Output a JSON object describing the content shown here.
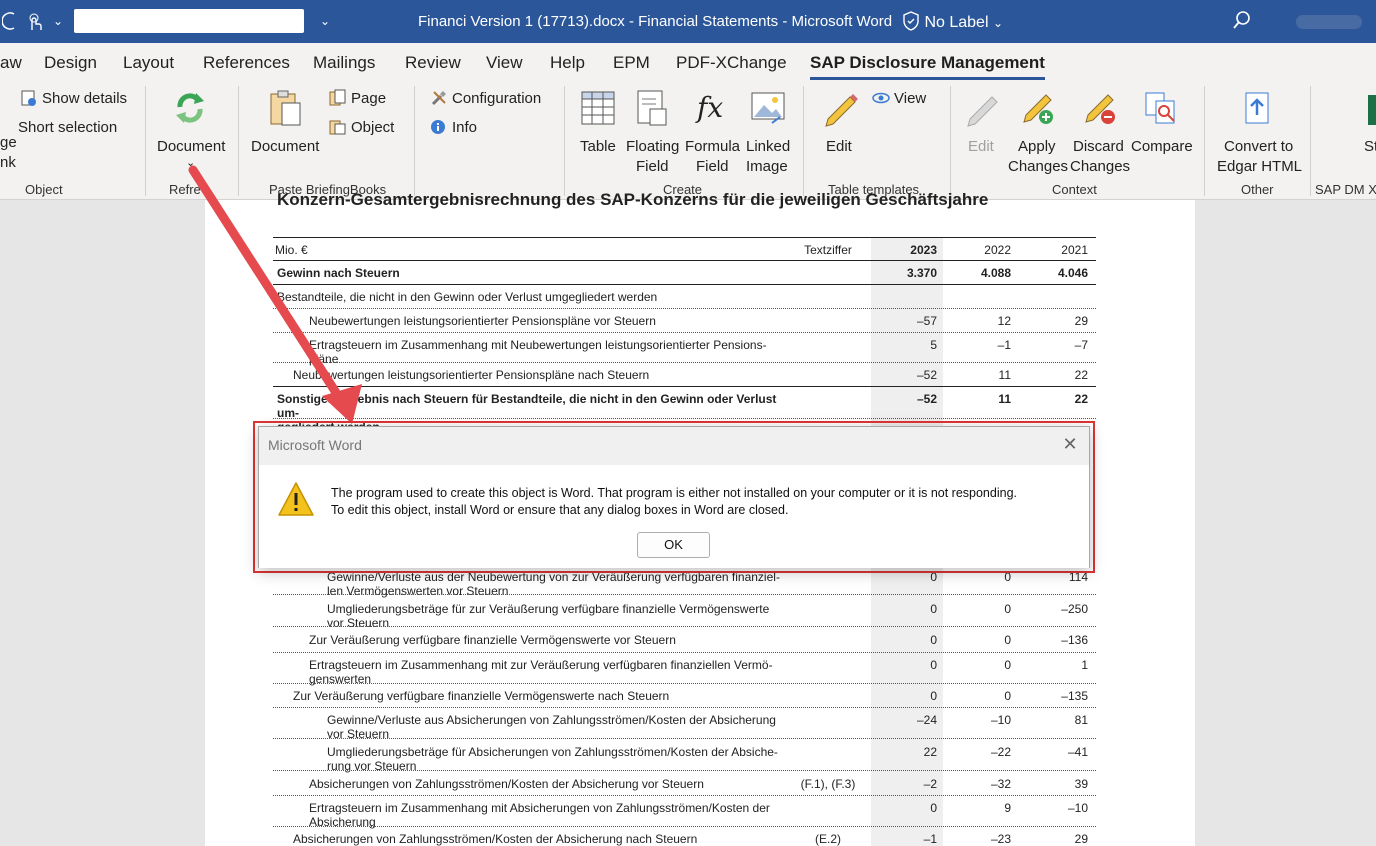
{
  "titlebar": {
    "title": "Financi Version 1 (17713).docx  -  Financial Statements  -  Microsoft Word",
    "label": "No Label",
    "icons": [
      "refresh-icon",
      "touch-icon",
      "dropdown-icon",
      "customize-icon",
      "shield-icon",
      "search-icon"
    ]
  },
  "tabs": [
    "aw",
    "Design",
    "Layout",
    "References",
    "Mailings",
    "Review",
    "View",
    "Help",
    "EPM",
    "PDF-XChange",
    "SAP Disclosure Management"
  ],
  "ribbon": {
    "object_group": {
      "show_details": "Show details",
      "short_selection": "Short selection",
      "partial_top": "ge",
      "partial_bottom": "nk",
      "label": "Object"
    },
    "refresh_group": {
      "document": "Document",
      "label": "Refre"
    },
    "paste_group": {
      "document": "Document",
      "page": "Page",
      "object": "Object",
      "label": "Paste BriefingBooks"
    },
    "config_group": {
      "configuration": "Configuration",
      "info": "Info"
    },
    "create_group": {
      "table": "Table",
      "floating_1": "Floating",
      "floating_2": "Field",
      "formula_1": "Formula",
      "formula_2": "Field",
      "linked_1": "Linked",
      "linked_2": "Image",
      "label": "Create"
    },
    "templates_group": {
      "edit": "Edit",
      "view": "View",
      "label": "Table templates"
    },
    "context_group": {
      "edit": "Edit",
      "apply_1": "Apply",
      "apply_2": "Changes",
      "discard_1": "Discard",
      "discard_2": "Changes",
      "compare": "Compare",
      "label": "Context"
    },
    "other_group": {
      "convert_1": "Convert to",
      "convert_2": "Edgar HTML",
      "label": "Other"
    },
    "sapdm_group": {
      "partial": "St",
      "label": "SAP DM XI"
    }
  },
  "document": {
    "heading": "Konzern-Gesamtergebnisrechnung des SAP-Konzerns für die jeweiligen Geschäftsjahre",
    "headers": {
      "label": "Mio. €",
      "tz": "Textziffer",
      "y2023": "2023",
      "y2022": "2022",
      "y2021": "2021"
    },
    "highlight_color": "#ffc000",
    "rows": [
      {
        "label": "Gewinn nach Steuern",
        "tz": "",
        "v23": "3.370",
        "v22": "4.088",
        "v21": "4.046"
      },
      {
        "label": "Bestandteile, die nicht in den Gewinn oder Verlust umgegliedert werden",
        "tz": "",
        "v23": "",
        "v22": "",
        "v21": ""
      },
      {
        "label": "Neubewertungen leistungsorientierter Pensionspläne vor Steuern",
        "tz": "",
        "v23": "–57",
        "v22": "12",
        "v21": "29"
      },
      {
        "label": "Ertragsteuern im Zusammenhang mit Neubewertungen leistungsorientierter Pensions-",
        "label2": "pläne",
        "tz": "",
        "v23": "5",
        "v22": "–1",
        "v21": "–7"
      },
      {
        "label": "Neubewertungen leistungsorientierter Pensionspläne nach Steuern",
        "tz": "",
        "v23": "–52",
        "v22": "11",
        "v21": "22"
      },
      {
        "label": "Sonstiges Ergebnis nach Steuern für Bestandteile, die nicht in den Gewinn oder Verlust um-",
        "label2": "gegliedert werden",
        "tz": "",
        "v23": "–52",
        "v22": "11",
        "v21": "22"
      },
      {
        "label": "Gewinne/Verluste aus der Neubewertung von zur Veräußerung verfügbaren finanziel-",
        "label2": "len Vermögenswerten vor Steuern",
        "tz": "",
        "v23": "0",
        "v22": "0",
        "v21": "114"
      },
      {
        "label": "Umgliederungsbeträge für zur Veräußerung verfügbare finanzielle Vermögenswerte",
        "label2": "vor Steuern",
        "tz": "",
        "v23": "0",
        "v22": "0",
        "v21": "–250"
      },
      {
        "label": "Zur Veräußerung verfügbare finanzielle Vermögenswerte vor Steuern",
        "tz": "",
        "v23": "0",
        "v22": "0",
        "v21": "–136"
      },
      {
        "label": "Ertragsteuern im Zusammenhang mit zur Veräußerung verfügbaren finanziellen Vermö-",
        "label2": "genswerten",
        "tz": "",
        "v23": "0",
        "v22": "0",
        "v21": "1"
      },
      {
        "label": "Zur Veräußerung verfügbare finanzielle Vermögenswerte nach Steuern",
        "tz": "",
        "v23": "0",
        "v22": "0",
        "v21": "–135"
      },
      {
        "label": "Gewinne/Verluste aus Absicherungen von Zahlungsströmen/Kosten der Absicherung",
        "label2": "vor Steuern",
        "tz": "",
        "v23": "–24",
        "v22": "–10",
        "v21": "81"
      },
      {
        "label": "Umgliederungsbeträge für Absicherungen von Zahlungsströmen/Kosten der Absiche-",
        "label2": "rung vor Steuern",
        "tz": "",
        "v23": "22",
        "v22": "–22",
        "v21": "–41"
      },
      {
        "label": "Absicherungen von Zahlungsströmen/Kosten der Absicherung vor Steuern",
        "tz": "(F.1), (F.3)",
        "v23": "–2",
        "v22": "–32",
        "v21": "39"
      },
      {
        "label": "Ertragsteuern im Zusammenhang mit Absicherungen von Zahlungsströmen/Kosten der",
        "label2": "Absicherung",
        "tz": "",
        "v23": "0",
        "v22": "9",
        "v21": "–10"
      },
      {
        "label": "Absicherungen von Zahlungsströmen/Kosten der Absicherung nach Steuern",
        "tz": "(E.2)",
        "v23": "–1",
        "v22": "–23",
        "v21": "29"
      }
    ]
  },
  "dialog": {
    "title": "Microsoft Word",
    "message_line1": "The program used to create this object is Word.  That program is either not installed on your computer or it is not responding.",
    "message_line2": "To edit this object, install Word or ensure that any dialog boxes in Word are closed.",
    "ok": "OK",
    "outline_color": "#e03434"
  }
}
